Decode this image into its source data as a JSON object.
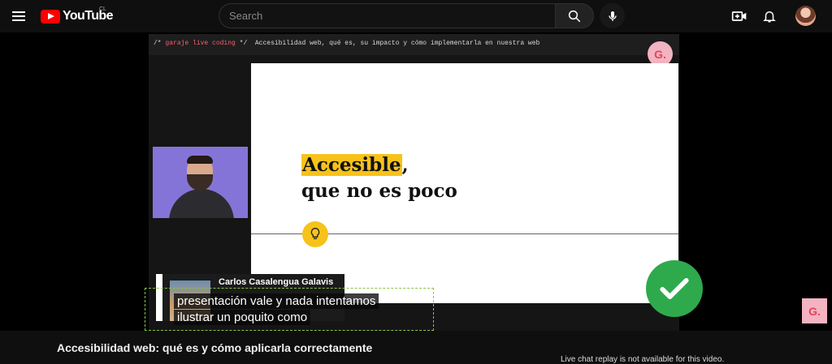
{
  "header": {
    "logo_text": "YouTube",
    "country": "CL",
    "search_placeholder": "Search"
  },
  "video": {
    "code_bar": {
      "comment_open": "/*",
      "channel": "garaje live coding",
      "comment_close": "*/",
      "title": "Accesibilidad web, qué es, su impacto y cómo implementarla en nuestra web"
    },
    "brand_badge": "G.",
    "slide": {
      "highlight": "Accesible",
      "after_highlight": ",",
      "line2": "que no es poco"
    },
    "chat": {
      "author": "Carlos Casalengua Galavis"
    },
    "captions": [
      "presentación vale y nada intentamos",
      "ilustrar un poquito como"
    ],
    "side_badge": "G."
  },
  "below": {
    "title": "Accesibilidad web: qué es y cómo aplicarla correctamente",
    "live_chat_note": "Live chat replay is not available for this video."
  },
  "colors": {
    "accent": "#ff0000",
    "highlight": "#f7c21a",
    "brand_pink": "#f3b3c1",
    "check_green": "#2eaa4d",
    "caption_border": "#8bc34a"
  }
}
